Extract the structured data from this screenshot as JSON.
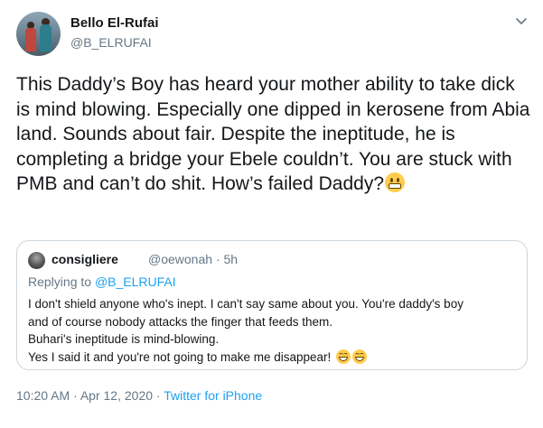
{
  "author": {
    "display_name": "Bello El-Rufai",
    "handle": "@B_ELRUFAI"
  },
  "tweet": {
    "text": "This Daddy’s Boy has heard your mother ability to take dick is mind blowing. Especially one dipped in kerosene from Abia land. Sounds about fair. Despite the ineptitude, he is completing a bridge your Ebele couldn’t. You are stuck with PMB and can’t do shit. How’s failed Daddy?",
    "emoji": "grimacing-face"
  },
  "quoted_tweet": {
    "display_name": "consigliere",
    "handle": "@oewonah",
    "separator": "·",
    "age": "5h",
    "replying_prefix": "Replying to",
    "replying_to": "@B_ELRUFAI",
    "lines": [
      "I don't shield anyone who's inept. I can't say same about you. You're daddy's boy",
      "and of course nobody attacks the finger that feeds them.",
      "Buhari's ineptitude is mind-blowing.",
      "Yes I said it and you're not going to make me disappear!"
    ],
    "emoji": [
      "grinning-squinting-face",
      "grinning-squinting-face"
    ]
  },
  "footer": {
    "time": "10:20 AM",
    "separator": "·",
    "date": "Apr 12, 2020",
    "source": "Twitter for iPhone"
  },
  "icons": {
    "menu": "chevron-down-icon"
  },
  "colors": {
    "link": "#1da1f2",
    "secondary_text": "#657786",
    "border": "#ccd6dd"
  }
}
